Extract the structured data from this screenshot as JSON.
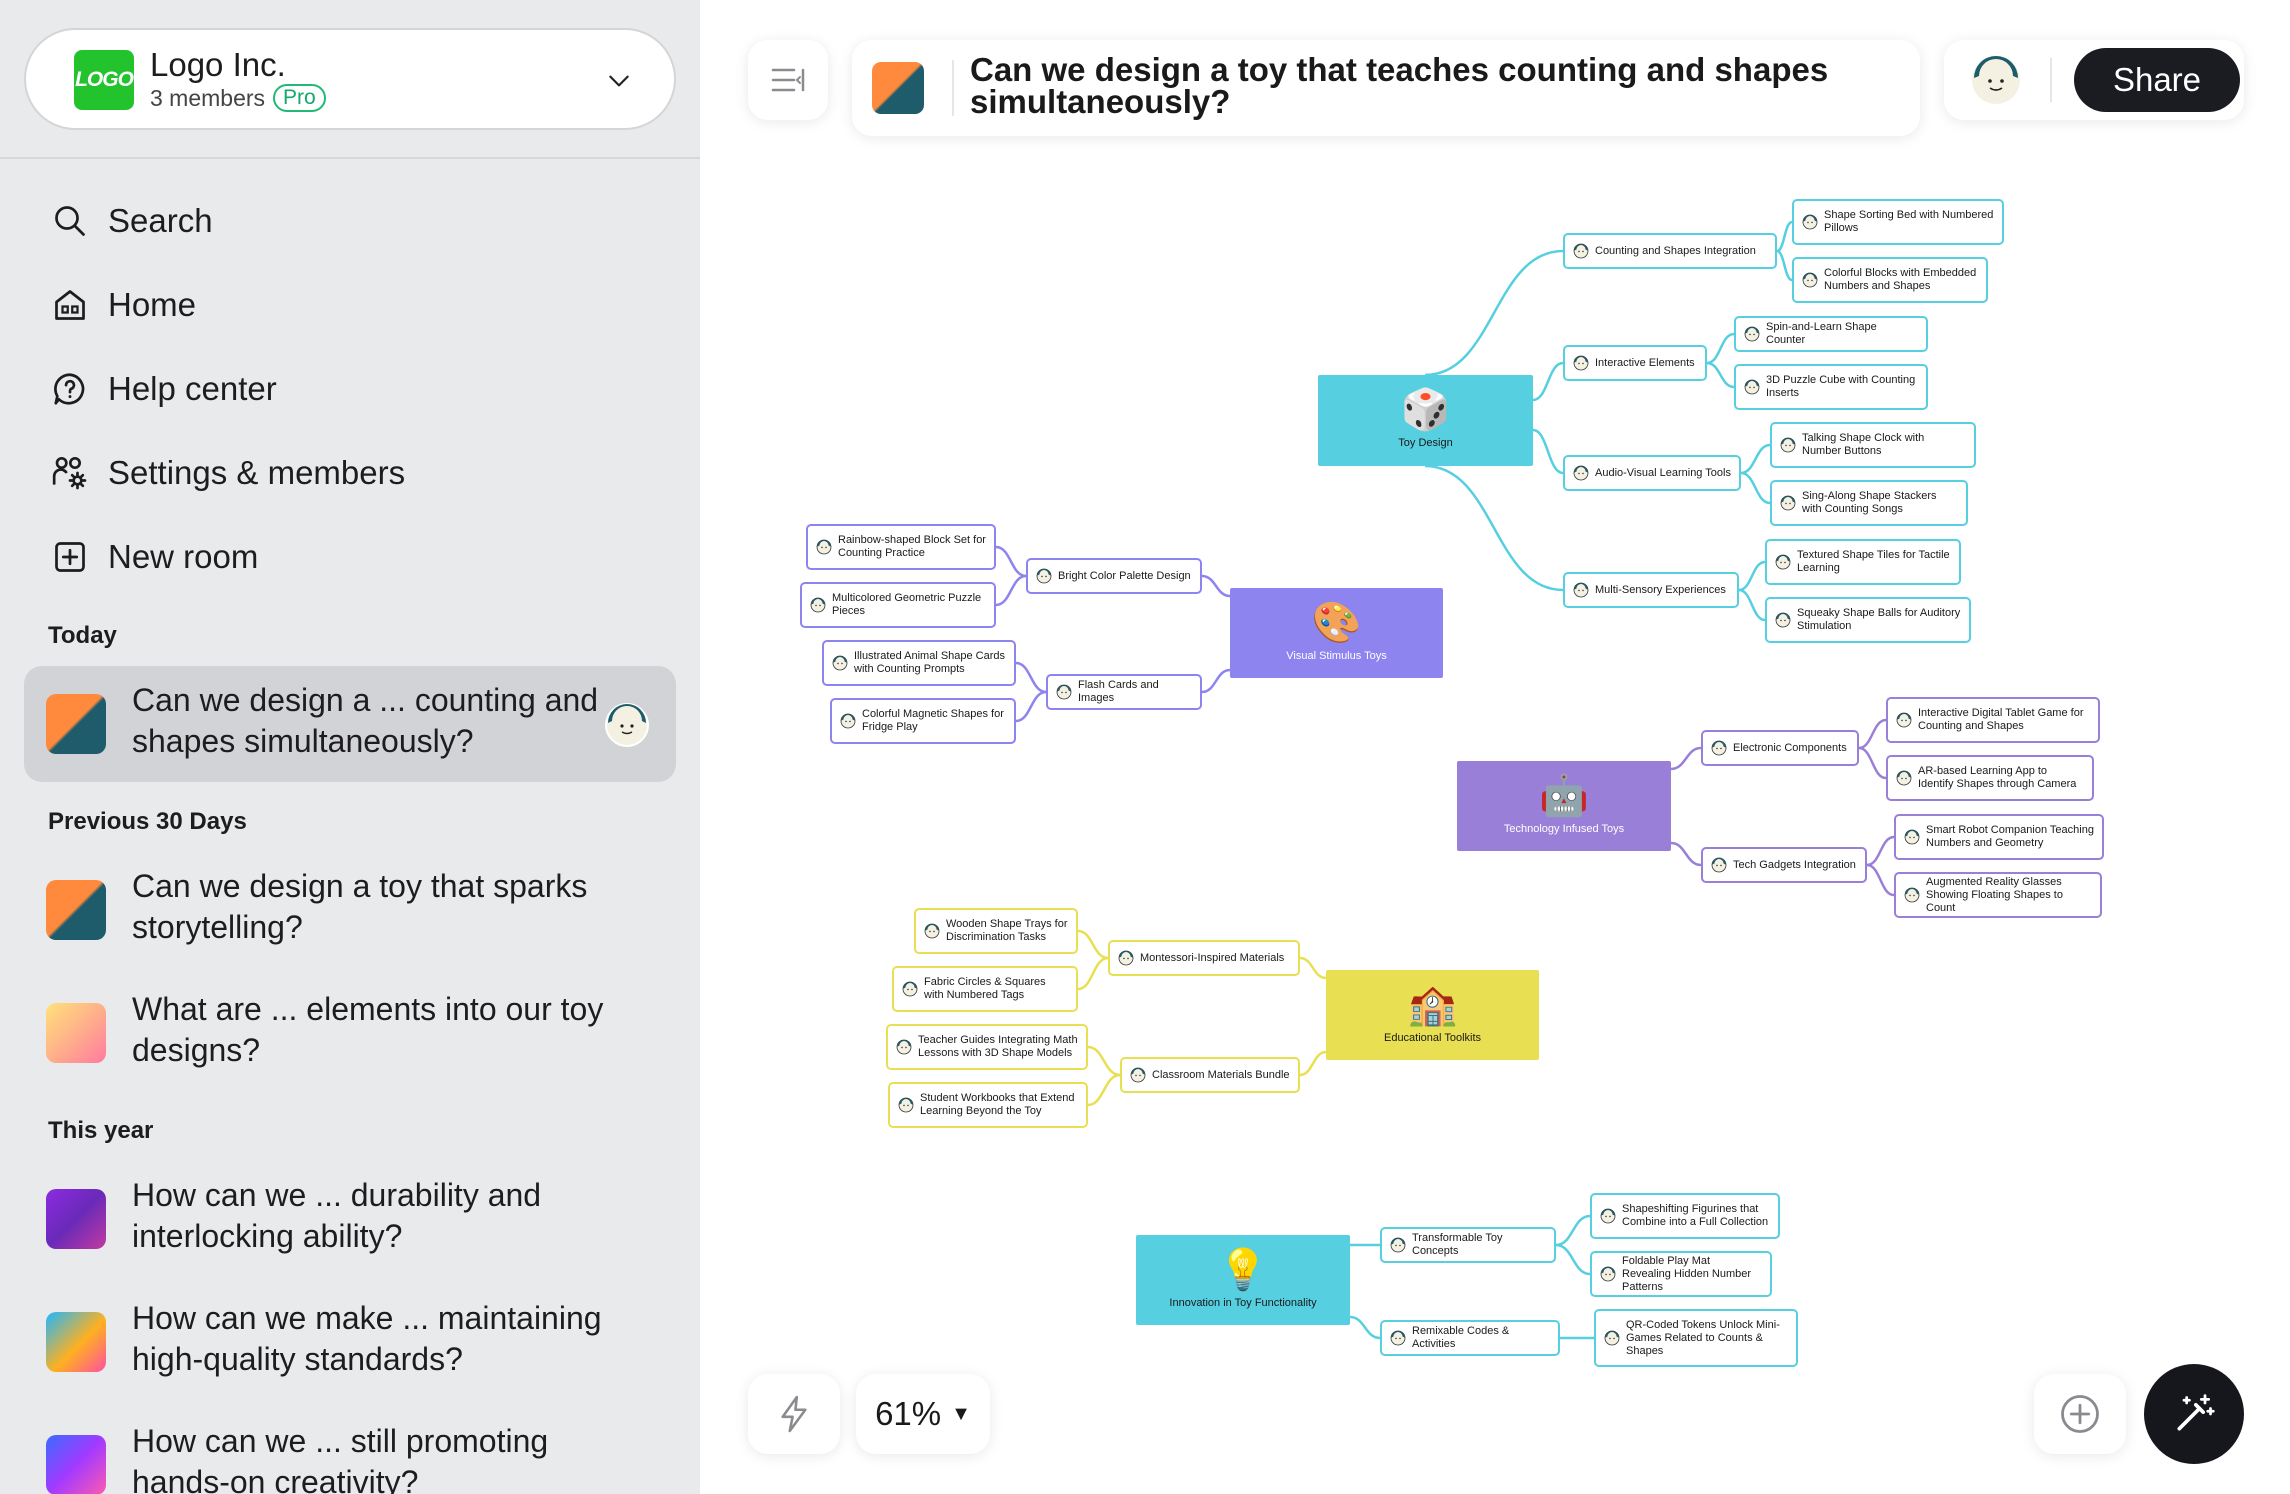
{
  "workspace": {
    "logo": "LOGO",
    "name": "Logo Inc.",
    "members": "3 members",
    "badge": "Pro"
  },
  "nav": [
    {
      "label": "Search",
      "icon": "search-icon"
    },
    {
      "label": "Home",
      "icon": "home-icon"
    },
    {
      "label": "Help center",
      "icon": "help-icon"
    },
    {
      "label": "Settings & members",
      "icon": "settings-members-icon"
    },
    {
      "label": "New room",
      "icon": "new-room-icon"
    }
  ],
  "sections": {
    "today": "Today",
    "previous": "Previous 30 Days",
    "year": "This year"
  },
  "rooms": [
    {
      "title": "Can we design a ... counting and shapes simultaneously?",
      "active": true
    },
    {
      "title": "Can we design a toy that sparks storytelling?"
    },
    {
      "title": "What are ... elements into our toy designs?"
    },
    {
      "title": "How can we ... durability and interlocking ability?"
    },
    {
      "title": "How can we make ... maintaining high-quality standards?"
    },
    {
      "title": "How can we ... still promoting hands-on creativity?"
    }
  ],
  "room_title": "Can we design a toy that teaches counting and shapes simultaneously?",
  "share_label": "Share",
  "zoom": "61%",
  "colors": {
    "cyan": "#56cfe0",
    "periwinkle": "#8e84f0",
    "violet": "#9a7fd8",
    "yellow": "#e8e052",
    "share": "#1a1c22"
  },
  "mindmap": {
    "hubs": [
      {
        "label": "Toy Design",
        "icon": "dice-icon"
      },
      {
        "label": "Visual Stimulus Toys",
        "icon": "palette-icon"
      },
      {
        "label": "Technology Infused Toys",
        "icon": "robot-icon"
      },
      {
        "label": "Educational Toolkits",
        "icon": "school-icon"
      },
      {
        "label": "Innovation in Toy Functionality",
        "icon": "lightbulb-icon"
      }
    ],
    "toy_design": [
      {
        "label": "Counting and Shapes Integration",
        "children": [
          "Shape Sorting Bed with Numbered Pillows",
          "Colorful Blocks with Embedded Numbers and Shapes"
        ]
      },
      {
        "label": "Interactive Elements",
        "children": [
          "Spin-and-Learn Shape Counter",
          "3D Puzzle Cube with Counting Inserts"
        ]
      },
      {
        "label": "Audio-Visual Learning Tools",
        "children": [
          "Talking Shape Clock with Number Buttons",
          "Sing-Along Shape Stackers with Counting Songs"
        ]
      },
      {
        "label": "Multi-Sensory Experiences",
        "children": [
          "Textured Shape Tiles for Tactile Learning",
          "Squeaky Shape Balls for Auditory Stimulation"
        ]
      }
    ],
    "visual": [
      {
        "label": "Bright Color Palette Design",
        "children": [
          "Rainbow-shaped Block Set for Counting Practice",
          "Multicolored Geometric Puzzle Pieces"
        ]
      },
      {
        "label": "Flash Cards and Images",
        "children": [
          "Illustrated Animal Shape Cards with Counting Prompts",
          "Colorful Magnetic Shapes for Fridge Play"
        ]
      }
    ],
    "tech": [
      {
        "label": "Electronic Components",
        "children": [
          "Interactive Digital Tablet Game for Counting and Shapes",
          "AR-based Learning App to Identify Shapes through Camera"
        ]
      },
      {
        "label": "Tech Gadgets Integration",
        "children": [
          "Smart Robot Companion Teaching Numbers and Geometry",
          "Augmented Reality Glasses Showing Floating Shapes to Count"
        ]
      }
    ],
    "edu": [
      {
        "label": "Montessori-Inspired Materials",
        "children": [
          "Wooden Shape Trays for Discrimination Tasks",
          "Fabric Circles & Squares with Numbered Tags"
        ]
      },
      {
        "label": "Classroom Materials Bundle",
        "children": [
          "Teacher Guides Integrating Math Lessons with 3D Shape Models",
          "Student Workbooks that Extend Learning Beyond the Toy"
        ]
      }
    ],
    "innov": [
      {
        "label": "Transformable Toy Concepts",
        "children": [
          "Shapeshifting Figurines that Combine into a Full Collection",
          "Foldable Play Mat Revealing Hidden Number Patterns"
        ]
      },
      {
        "label": "Remixable Codes & Activities",
        "children": [
          "QR-Coded Tokens Unlock Mini-Games Related to Counts & Shapes"
        ]
      }
    ]
  }
}
